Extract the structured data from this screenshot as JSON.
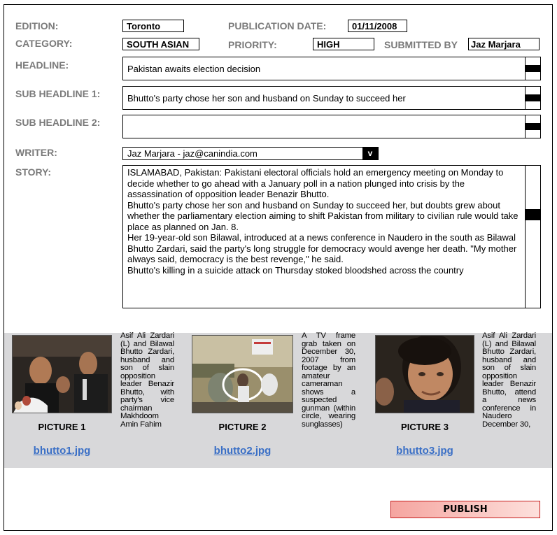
{
  "form": {
    "edition_label": "EDITION:",
    "edition_value": "Toronto",
    "pubdate_label": "PUBLICATION DATE:",
    "pubdate_value": "01/11/2008",
    "category_label": "CATEGORY:",
    "category_value": "SOUTH ASIAN",
    "priority_label": "PRIORITY:",
    "priority_value": "HIGH",
    "submitted_label": "SUBMITTED BY",
    "submitted_value": "Jaz Marjara",
    "headline_label": "HEADLINE:",
    "headline_value": "Pakistan awaits election decision",
    "sub1_label": "SUB HEADLINE 1:",
    "sub1_value": "Bhutto's party chose her son and husband on Sunday to succeed her",
    "sub2_label": "SUB HEADLINE 2:",
    "sub2_value": "",
    "writer_label": "WRITER:",
    "writer_value": "Jaz Marjara  -  jaz@canindia.com",
    "writer_dropdown": "v",
    "story_label": "STORY:",
    "story_paragraphs": [
      "ISLAMABAD, Pakistan: Pakistani electoral officials hold an emergency meeting on Monday to decide whether to go ahead with a January poll in a nation plunged into crisis by the assassination of opposition leader Benazir Bhutto.",
      "Bhutto's party chose her son and husband on Sunday to succeed her, but doubts grew about whether the parliamentary election aiming to shift Pakistan from military to civilian rule would take place as planned on Jan. 8.",
      "Her 19-year-old son Bilawal, introduced at a news conference in Naudero in the south as Bilawal Bhutto Zardari, said the party's long struggle for democracy would avenge her death. \"My mother always said, democracy is the best revenge,\" he said.",
      "Bhutto's killing in a suicide attack on Thursday stoked bloodshed across the country"
    ]
  },
  "pictures": [
    {
      "name": "PICTURE 1",
      "file": "bhutto1.jpg",
      "caption": "Asif Ali Zardari (L) and Bilawal Bhutto Zardari, husband and son of slain opposition leader Benazir Bhutto, with party's vice chairman Makhdoom Amin Fahim"
    },
    {
      "name": "PICTURE 2",
      "file": "bhutto2.jpg",
      "caption": "A TV frame grab taken on December 30, 2007 from footage by an amateur cameraman shows a suspected gunman (within circle, wearing sunglasses)"
    },
    {
      "name": "PICTURE 3",
      "file": "bhutto3.jpg",
      "caption": "Asif Ali Zardari (L) and Bilawal Bhutto Zardari, husband and son of slain opposition leader Benazir Bhutto, attend a news conference in Naudero December 30,"
    }
  ],
  "publish_label": "PUBLISH",
  "colors": {
    "label_gray": "#7a7a7a",
    "band_gray": "#d8d8da",
    "link_blue": "#3a6fc6",
    "publish_border": "#c61d1d",
    "publish_fill": "#f5a5a0"
  }
}
